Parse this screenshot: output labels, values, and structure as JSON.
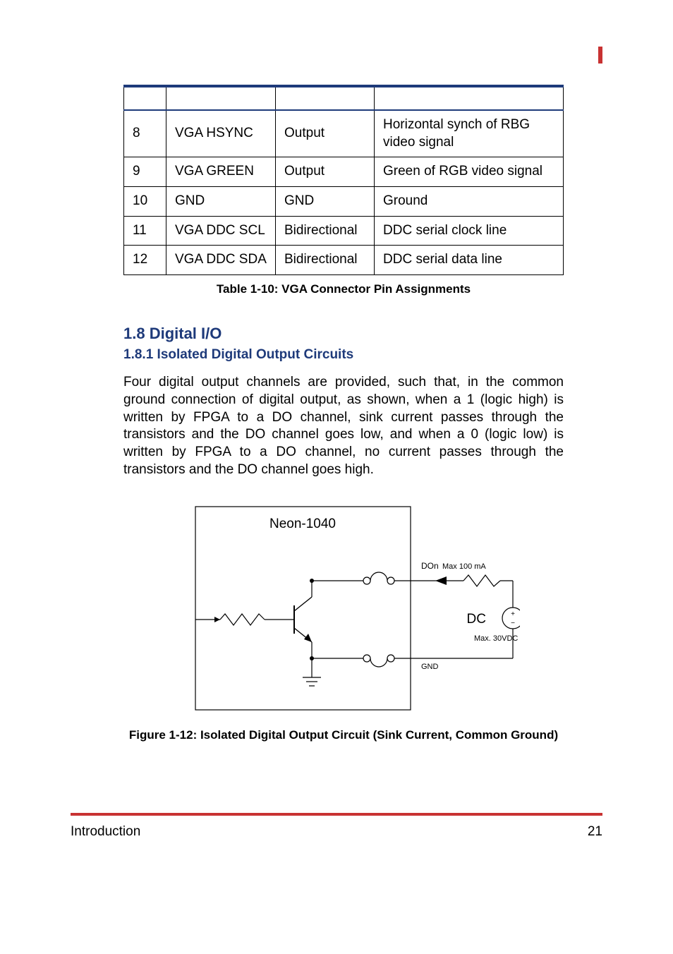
{
  "table": {
    "rows": [
      {
        "pin": "8",
        "signal": "VGA HSYNC",
        "type": "Output",
        "desc": "Horizontal synch of RBG video signal"
      },
      {
        "pin": "9",
        "signal": "VGA GREEN",
        "type": "Output",
        "desc": "Green of RGB video signal"
      },
      {
        "pin": "10",
        "signal": "GND",
        "type": "GND",
        "desc": "Ground"
      },
      {
        "pin": "11",
        "signal": "VGA DDC SCL",
        "type": "Bidirectional",
        "desc": "DDC serial clock line"
      },
      {
        "pin": "12",
        "signal": "VGA DDC SDA",
        "type": "Bidirectional",
        "desc": "DDC serial data line"
      }
    ],
    "caption": "Table 1-10: VGA Connector Pin Assignments"
  },
  "section": {
    "heading": "1.8 Digital I/O",
    "subheading": "1.8.1 Isolated Digital Output Circuits",
    "body": "Four digital output channels are provided, such that, in the common ground connection of digital output, as shown, when a 1 (logic high) is written by FPGA to a DO channel, sink current passes through the transistors and the DO channel goes low, and when a 0 (logic low) is written by FPGA to a DO channel, no current passes through the transistors and the DO channel goes high."
  },
  "diagram": {
    "title": "Neon-1040",
    "do_label": "DOn",
    "max_current": "Max 100 mA",
    "dc_label": "DC",
    "dc_plus": "+",
    "dc_minus": "−",
    "max_vdc": "Max. 30VDC",
    "gnd_label": "GND"
  },
  "figure_caption": "Figure 1-12: Isolated Digital Output Circuit (Sink Current, Common Ground)",
  "footer": {
    "left": "Introduction",
    "right": "21"
  }
}
